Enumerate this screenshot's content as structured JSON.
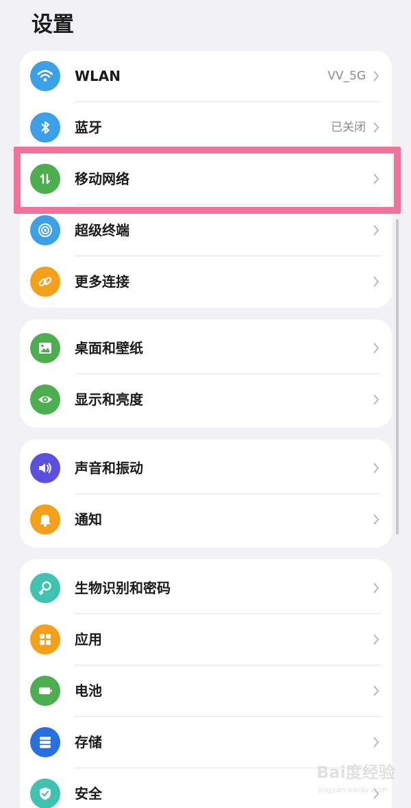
{
  "title": "设置",
  "groups": [
    {
      "items": [
        {
          "label": "WLAN",
          "value": "VV_5G",
          "icon": "wifi-icon",
          "color": "#3ba0e8"
        },
        {
          "label": "蓝牙",
          "value": "已关闭",
          "icon": "bluetooth-icon",
          "color": "#3ba0e8"
        },
        {
          "label": "移动网络",
          "value": "",
          "icon": "mobile-network-icon",
          "color": "#4cae4f"
        },
        {
          "label": "超级终端",
          "value": "",
          "icon": "super-device-icon",
          "color": "#3ba0e8"
        },
        {
          "label": "更多连接",
          "value": "",
          "icon": "link-icon",
          "color": "#f5a01a"
        }
      ]
    },
    {
      "items": [
        {
          "label": "桌面和壁纸",
          "value": "",
          "icon": "wallpaper-icon",
          "color": "#4cae4f"
        },
        {
          "label": "显示和亮度",
          "value": "",
          "icon": "eye-icon",
          "color": "#4cae4f"
        }
      ]
    },
    {
      "items": [
        {
          "label": "声音和振动",
          "value": "",
          "icon": "speaker-icon",
          "color": "#5b4fe0"
        },
        {
          "label": "通知",
          "value": "",
          "icon": "bell-icon",
          "color": "#f5a01a"
        }
      ]
    },
    {
      "items": [
        {
          "label": "生物识别和密码",
          "value": "",
          "icon": "key-icon",
          "color": "#3fc2b0"
        },
        {
          "label": "应用",
          "value": "",
          "icon": "apps-icon",
          "color": "#f5a01a"
        },
        {
          "label": "电池",
          "value": "",
          "icon": "battery-icon",
          "color": "#4cae4f"
        },
        {
          "label": "存储",
          "value": "",
          "icon": "storage-icon",
          "color": "#2a6fe0"
        },
        {
          "label": "安全",
          "value": "",
          "icon": "shield-icon",
          "color": "#3fc2b0"
        }
      ]
    }
  ],
  "highlight_color": "#f27399",
  "watermark": {
    "logo": "Bai度经验",
    "url": "jingyan.baidu.com"
  }
}
